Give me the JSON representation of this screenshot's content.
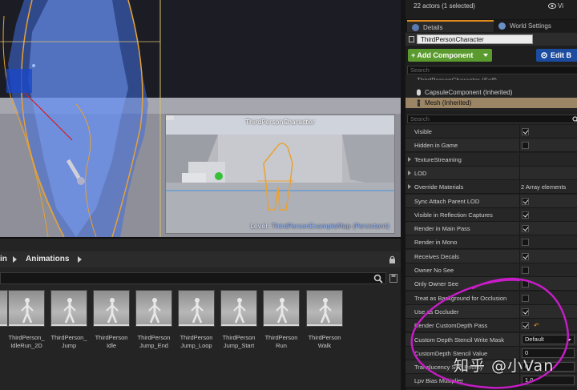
{
  "viewport": {
    "preview_title": "ThirdPersonCharacter",
    "level_prefix": "Level:",
    "level_name": "ThirdPersonExampleMap (Persistent)"
  },
  "content_browser": {
    "breadcrumb_prev": "in",
    "breadcrumb_current": "Animations",
    "assets": [
      {
        "label": "_"
      },
      {
        "label": "ThirdPerson_\nIdleRun_2D"
      },
      {
        "label": "ThirdPerson_\nJump"
      },
      {
        "label": "ThirdPerson\nIdle"
      },
      {
        "label": "ThirdPerson\nJump_End"
      },
      {
        "label": "ThirdPerson\nJump_Loop"
      },
      {
        "label": "ThirdPerson\nJump_Start"
      },
      {
        "label": "ThirdPerson\nRun"
      },
      {
        "label": "ThirdPerson\nWalk"
      }
    ]
  },
  "outliner": {
    "status": "22 actors (1 selected)",
    "view_options": "Vi"
  },
  "tabs": {
    "details": "Details",
    "world_settings": "World Settings"
  },
  "details": {
    "actor_name": "ThirdPersonCharacter",
    "add_component_label": "+ Add Component",
    "edit_blueprint_label": "Edit B",
    "search_placeholder": "Search",
    "hidden_row": "ThirdPersonCharacter (Self)",
    "capsule_label": "CapsuleComponent (Inherited)",
    "mesh_label": "Mesh (Inherited)",
    "props_search_placeholder": "Search",
    "properties": [
      {
        "name": "Visible",
        "kind": "checkbox",
        "checked": true
      },
      {
        "name": "Hidden in Game",
        "kind": "checkbox",
        "checked": false
      },
      {
        "name": "TextureStreaming",
        "kind": "group"
      },
      {
        "name": "LOD",
        "kind": "group"
      },
      {
        "name": "Override Materials",
        "kind": "group",
        "value": "2 Array elements"
      },
      {
        "name": "Sync Attach Parent LOD",
        "kind": "checkbox",
        "checked": true
      },
      {
        "name": "Visible in Reflection Captures",
        "kind": "checkbox",
        "checked": true
      },
      {
        "name": "Render in Main Pass",
        "kind": "checkbox",
        "checked": true
      },
      {
        "name": "Render in Mono",
        "kind": "checkbox",
        "checked": false
      },
      {
        "name": "Receives Decals",
        "kind": "checkbox",
        "checked": true
      },
      {
        "name": "Owner No See",
        "kind": "checkbox",
        "checked": false
      },
      {
        "name": "Only Owner See",
        "kind": "checkbox",
        "checked": false
      },
      {
        "name": "Treat as Background for Occlusion",
        "kind": "checkbox",
        "checked": false
      },
      {
        "name": "Use as Occluder",
        "kind": "checkbox",
        "checked": true
      },
      {
        "name": "Render CustomDepth Pass",
        "kind": "checkbox",
        "checked": true,
        "reset": true
      },
      {
        "name": "Custom Depth Stencil Write Mask",
        "kind": "dropdown",
        "value": "Default"
      },
      {
        "name": "CustomDepth Stencil Value",
        "kind": "number",
        "value": "0"
      },
      {
        "name": "Translucency Sort Priority",
        "kind": "number",
        "value": "0"
      },
      {
        "name": "Lpv Bias Multiplier",
        "kind": "number",
        "value": "1.0"
      }
    ]
  },
  "watermark": "知乎 @小Van",
  "colors": {
    "add_component": "#5b9a2e",
    "edit_blueprint": "#1c4ca0",
    "annotation": "#c81cc8",
    "selected_row": "#9c8565"
  }
}
